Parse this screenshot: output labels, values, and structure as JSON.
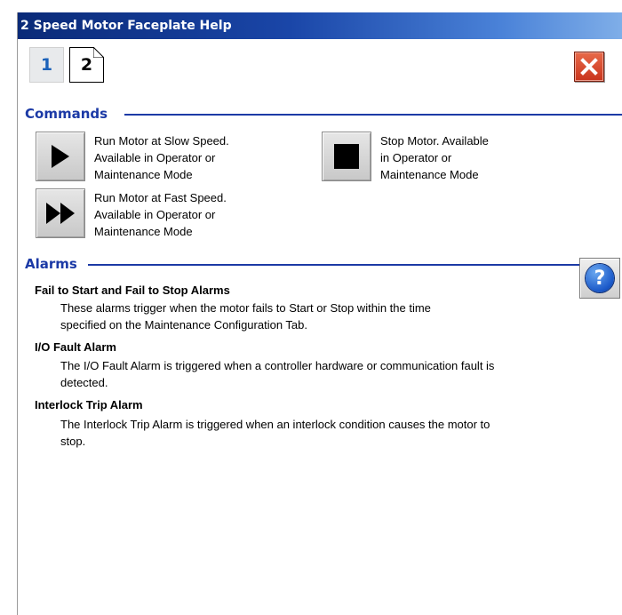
{
  "window": {
    "title": "2 Speed Motor Faceplate Help"
  },
  "pages": {
    "page1_label": "1",
    "page2_label": "2"
  },
  "commands": {
    "heading": "Commands",
    "run_slow": {
      "line1": "Run Motor at Slow Speed.",
      "line2": "Available in Operator or",
      "line3": "Maintenance Mode"
    },
    "run_fast": {
      "line1": "Run Motor at Fast Speed.",
      "line2": "Available in Operator or",
      "line3": "Maintenance Mode"
    },
    "stop": {
      "line1": "Stop Motor.  Available",
      "line2": "in Operator or",
      "line3": "Maintenance Mode"
    }
  },
  "alarms": {
    "heading": "Alarms",
    "help_glyph": "?",
    "items": [
      {
        "title": "Fail to Start and Fail to Stop Alarms",
        "line1": "These alarms trigger when the motor fails to Start or Stop within the time",
        "line2": "specified on the Maintenance Configuration Tab."
      },
      {
        "title": "I/O Fault Alarm",
        "line1": "The I/O Fault Alarm is triggered when a controller hardware or communication fault is",
        "line2": "detected."
      },
      {
        "title": "Interlock Trip Alarm",
        "line1": "The Interlock Trip Alarm is triggered when an interlock condition causes the motor to",
        "line2": "stop."
      }
    ]
  },
  "icons": {
    "close": "close-icon",
    "play": "play-icon",
    "fast_forward": "fast-forward-icon",
    "stop": "stop-icon",
    "help": "help-icon"
  },
  "colors": {
    "section_heading": "#1c3aa6",
    "close_button": "#d84a2c",
    "page1_text": "#1c62b9"
  }
}
